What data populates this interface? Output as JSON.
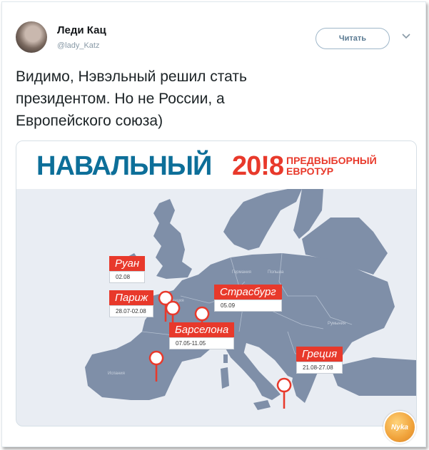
{
  "tweet": {
    "author_name": "Леди Кац",
    "author_handle": "@lady_Katz",
    "follow_label": "Читать",
    "text": "Видимо, Нэвэльный решил стать\nпрезидентом. Но не России, а\nЕвропейского союза)"
  },
  "card": {
    "title_name": "НАВАЛЬНЫЙ",
    "title_year": "20!8",
    "title_sub": "ПРЕДВЫБОРНЫЙ\nЕВРОТУР",
    "countries": {
      "germany": "Германия",
      "poland": "Польша",
      "france": "Франция",
      "spain": "Испания",
      "romania": "Румыния"
    },
    "stops": [
      {
        "city": "Руан",
        "date": "02.08"
      },
      {
        "city": "Париж",
        "date": "28.07-02.08"
      },
      {
        "city": "Страсбург",
        "date": "05.09"
      },
      {
        "city": "Барселона",
        "date": "07.05-11.05"
      },
      {
        "city": "Греция",
        "date": "21.08-27.08"
      }
    ]
  },
  "watermark": {
    "text": "Nyka"
  },
  "colors": {
    "accent_blue": "#0d6f99",
    "accent_red": "#e8392b",
    "map_land": "#7f8fa8",
    "sea": "#e9edf3"
  }
}
